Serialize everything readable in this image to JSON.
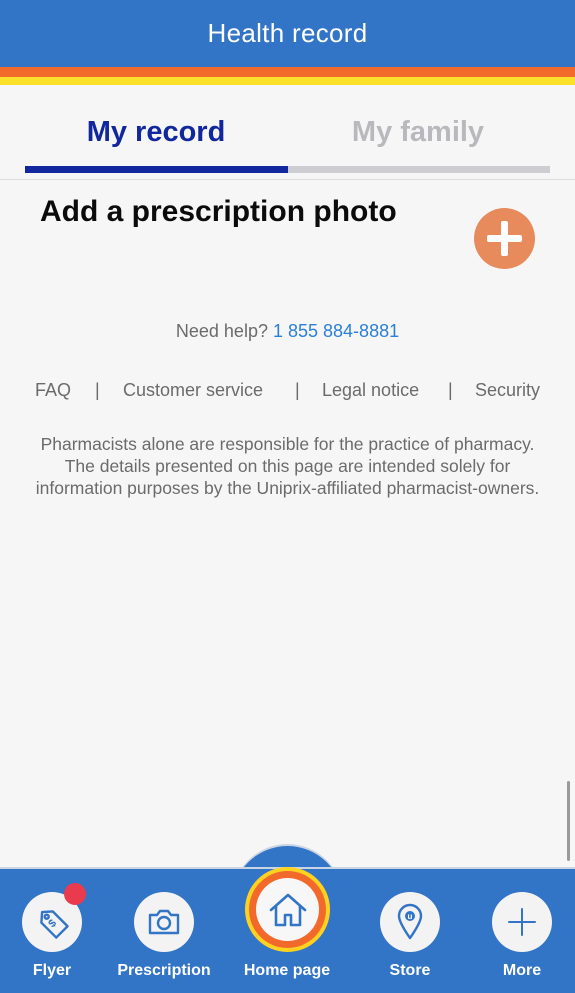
{
  "header": {
    "title": "Health record"
  },
  "tabs": [
    {
      "label": "My record",
      "active": true
    },
    {
      "label": "My family",
      "active": false
    }
  ],
  "prescription": {
    "title": "Add a prescription photo",
    "add_icon": "plus-icon"
  },
  "help": {
    "text": "Need help?",
    "phone": "1 855 884-8881"
  },
  "footer_links": [
    {
      "label": "FAQ"
    },
    {
      "label": "Customer service"
    },
    {
      "label": "Legal notice"
    },
    {
      "label": "Security"
    }
  ],
  "separator": "|",
  "disclaimer": "Pharmacists alone are responsible for the practice of pharmacy. The details presented on this page are intended solely for information purposes by the Uniprix-affiliated pharmacist-owners.",
  "bottom_nav": [
    {
      "label": "Flyer",
      "icon": "price-tag-icon",
      "has_badge": true
    },
    {
      "label": "Prescription",
      "icon": "camera-icon"
    },
    {
      "label": "Home page",
      "icon": "home-icon",
      "active": true
    },
    {
      "label": "Store",
      "icon": "map-pin-icon"
    },
    {
      "label": "More",
      "icon": "plus-icon"
    }
  ],
  "colors": {
    "header_blue": "#3274c6",
    "stripe_orange": "#f26a2b",
    "stripe_yellow": "#ffe02b",
    "tab_active": "#12279e",
    "add_button": "#e78a5c",
    "link_blue": "#2b7fd6",
    "badge_red": "#ea3a4e"
  }
}
